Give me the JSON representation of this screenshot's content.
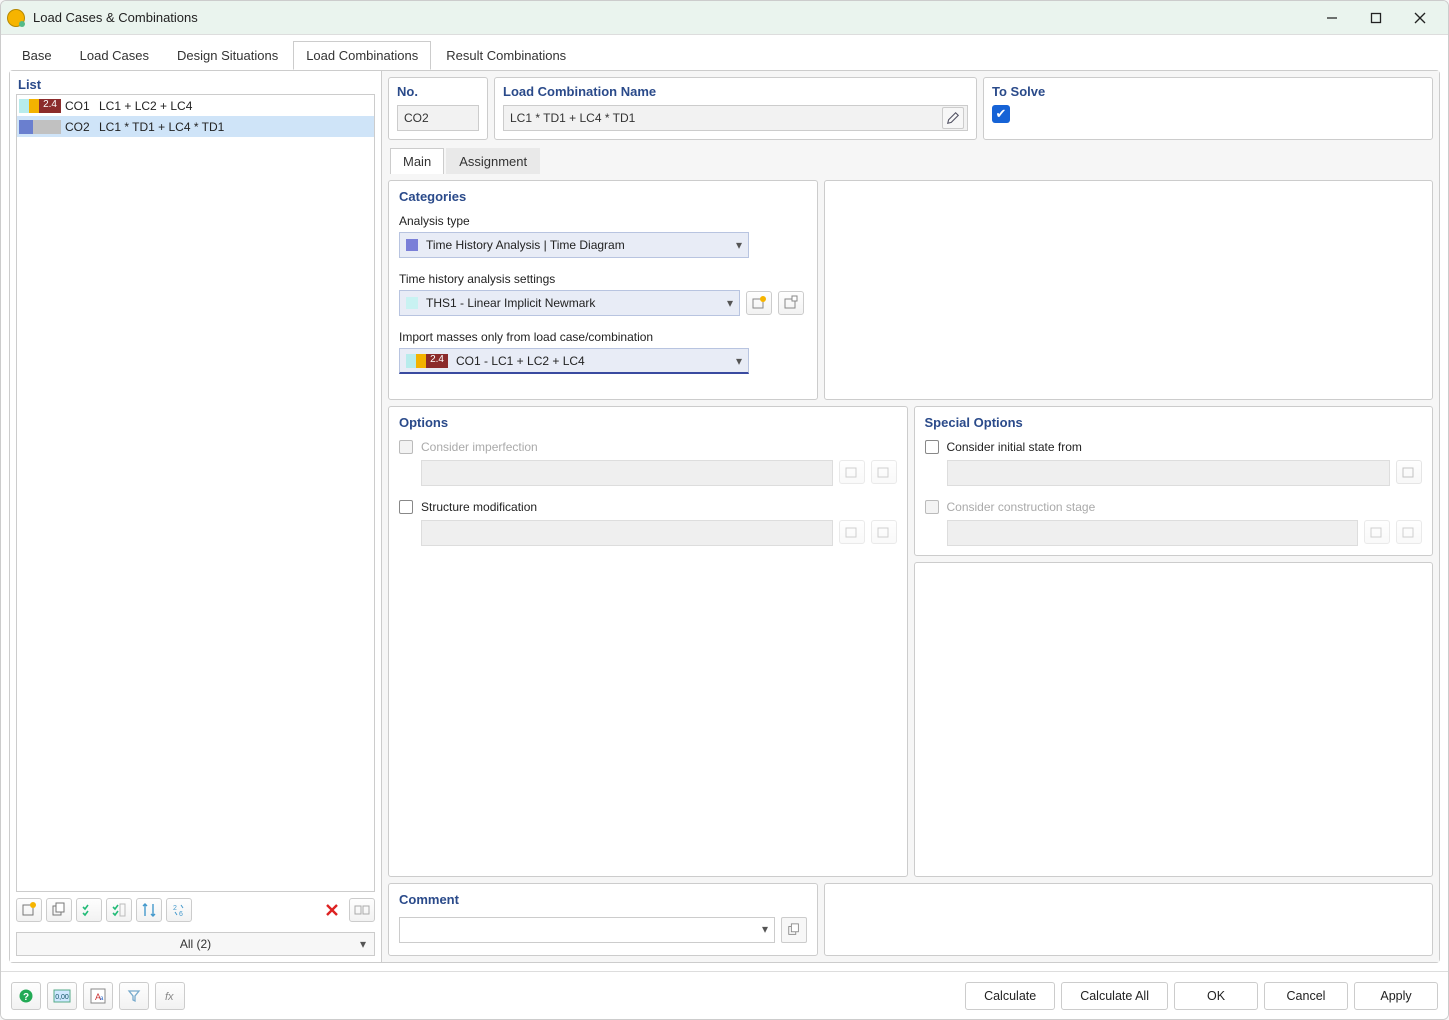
{
  "window": {
    "title": "Load Cases & Combinations"
  },
  "tabs": {
    "base": "Base",
    "load_cases": "Load Cases",
    "design_situations": "Design Situations",
    "load_combinations": "Load Combinations",
    "result_combinations": "Result Combinations"
  },
  "left": {
    "header": "List",
    "rows": [
      {
        "code": "CO1",
        "text": "LC1 + LC2 + LC4",
        "badge": "2.4",
        "colors": [
          "#b7ecec",
          "#f3b200",
          "#8b2b2b"
        ],
        "selected": false
      },
      {
        "code": "CO2",
        "text": "LC1 * TD1 + LC4 * TD1",
        "badge": "",
        "colors": [
          "#6a7fcf",
          "#c1c1c1"
        ],
        "selected": true
      }
    ],
    "filter": "All (2)"
  },
  "detail": {
    "no_label": "No.",
    "no_value": "CO2",
    "name_label": "Load Combination Name",
    "name_value": "LC1 * TD1 + LC4 * TD1",
    "solve_label": "To Solve",
    "solve_checked": true
  },
  "subtabs": {
    "main": "Main",
    "assignment": "Assignment"
  },
  "categories": {
    "title": "Categories",
    "analysis_type_label": "Analysis type",
    "analysis_type_value": "Time History Analysis | Time Diagram",
    "analysis_type_color": "#7a7fd8",
    "settings_label": "Time history analysis settings",
    "settings_value": "THS1 - Linear Implicit Newmark",
    "settings_color": "#c8f2f2",
    "import_label": "Import masses only from load case/combination",
    "import_value": "CO1 - LC1 + LC2 + LC4",
    "import_badge": "2.4",
    "import_colors": [
      "#b7ecec",
      "#f3b200",
      "#8b2b2b"
    ]
  },
  "options": {
    "title": "Options",
    "consider_imperfection": "Consider imperfection",
    "structure_modification": "Structure modification"
  },
  "special": {
    "title": "Special Options",
    "initial_state": "Consider initial state from",
    "construction_stage": "Consider construction stage"
  },
  "comment": {
    "title": "Comment"
  },
  "footer": {
    "calculate": "Calculate",
    "calculate_all": "Calculate All",
    "ok": "OK",
    "cancel": "Cancel",
    "apply": "Apply"
  }
}
